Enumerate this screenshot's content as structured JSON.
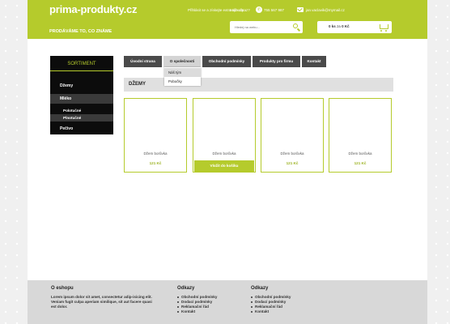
{
  "header": {
    "logo_text": "prima-produkty.cz",
    "tagline": "PRODÁVÁME TO, CO ZNÁME",
    "login_link": "Přihlásit se a získejte extra výhody",
    "contact_label": "Máte dotaz?",
    "phone": "755 567 987",
    "email": "jan.vaclavik@mymail.cz",
    "search_placeholder": "Hledej na webu...",
    "cart_count": "0 ks",
    "cart_mid": "za",
    "cart_total": "0 Kč",
    "accent_color": "#b5cb2c",
    "icons": [
      "phone-icon",
      "mail-icon",
      "search-icon",
      "cart-icon"
    ]
  },
  "sidebar": {
    "title": "SORTIMENT",
    "items": [
      {
        "label": "Džemy"
      },
      {
        "label": "Mléko"
      },
      {
        "label": "Polotučné"
      },
      {
        "label": "Plnotučné"
      },
      {
        "label": "Pečivo"
      }
    ]
  },
  "nav": {
    "tabs": [
      {
        "label": "Úvodní strana"
      },
      {
        "label": "O společnosti"
      },
      {
        "label": "Obchodní podmínky"
      },
      {
        "label": "Produkty pro firmu"
      },
      {
        "label": "Kontakt"
      }
    ],
    "dropdown": [
      {
        "label": "Náš tým"
      },
      {
        "label": "Pobočky"
      }
    ]
  },
  "main": {
    "section_title": "DŽEMY",
    "products": [
      {
        "name": "Džem borůvka",
        "price": "121 Kč"
      },
      {
        "name": "Džem borůvka",
        "price": "121 Kč"
      },
      {
        "name": "Džem borůvka",
        "price": "121 Kč"
      },
      {
        "name": "Džem borůvka",
        "price": "121 Kč"
      }
    ],
    "cart_button": "Vložit do košíku"
  },
  "footer": {
    "about_title": "O eshopu",
    "about_text": "Lorem ipsum dolor sit amet, consectetur adip-isicing elit. Veniam fugit culpa aperiam similique, sit aut facere quasi est dolor.",
    "links_title_1": "Odkazy",
    "links_1": [
      "Obchodní podmínky",
      "Dodací podmínky",
      "Reklamační řád",
      "Kontakt"
    ],
    "links_title_2": "Odkazy",
    "links_2": [
      "Obchodní podmínky",
      "Dodací podmínky",
      "Reklamační řád",
      "Kontakt"
    ]
  }
}
